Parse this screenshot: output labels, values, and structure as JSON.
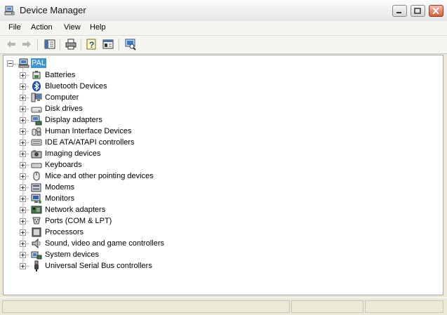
{
  "window": {
    "title": "Device Manager",
    "icon": "device-manager-icon"
  },
  "menu": [
    "File",
    "Action",
    "View",
    "Help"
  ],
  "toolbar": {
    "buttons": [
      "back-arrow-icon",
      "forward-arrow-icon",
      "show-hide-console-tree-icon",
      "print-icon",
      "help-icon",
      "properties-icon",
      "scan-hardware-icon"
    ]
  },
  "tree": {
    "root": {
      "label": "PAL",
      "icon": "computer-root-icon",
      "expanded": true,
      "selected": true
    },
    "categories": [
      {
        "label": "Batteries",
        "icon": "battery-icon"
      },
      {
        "label": "Bluetooth Devices",
        "icon": "bluetooth-icon"
      },
      {
        "label": "Computer",
        "icon": "computer-icon"
      },
      {
        "label": "Disk drives",
        "icon": "disk-drive-icon"
      },
      {
        "label": "Display adapters",
        "icon": "display-adapter-icon"
      },
      {
        "label": "Human Interface Devices",
        "icon": "hid-icon"
      },
      {
        "label": "IDE ATA/ATAPI controllers",
        "icon": "ide-controller-icon"
      },
      {
        "label": "Imaging devices",
        "icon": "camera-icon"
      },
      {
        "label": "Keyboards",
        "icon": "keyboard-icon"
      },
      {
        "label": "Mice and other pointing devices",
        "icon": "mouse-icon"
      },
      {
        "label": "Modems",
        "icon": "modem-icon"
      },
      {
        "label": "Monitors",
        "icon": "monitor-icon"
      },
      {
        "label": "Network adapters",
        "icon": "network-adapter-icon"
      },
      {
        "label": "Ports (COM & LPT)",
        "icon": "port-icon"
      },
      {
        "label": "Processors",
        "icon": "processor-icon"
      },
      {
        "label": "Sound, video and game controllers",
        "icon": "speaker-icon"
      },
      {
        "label": "System devices",
        "icon": "system-device-icon"
      },
      {
        "label": "Universal Serial Bus controllers",
        "icon": "usb-icon"
      }
    ]
  },
  "colors": {
    "selection": "#3d95d4",
    "chrome": "#ece9d8"
  }
}
